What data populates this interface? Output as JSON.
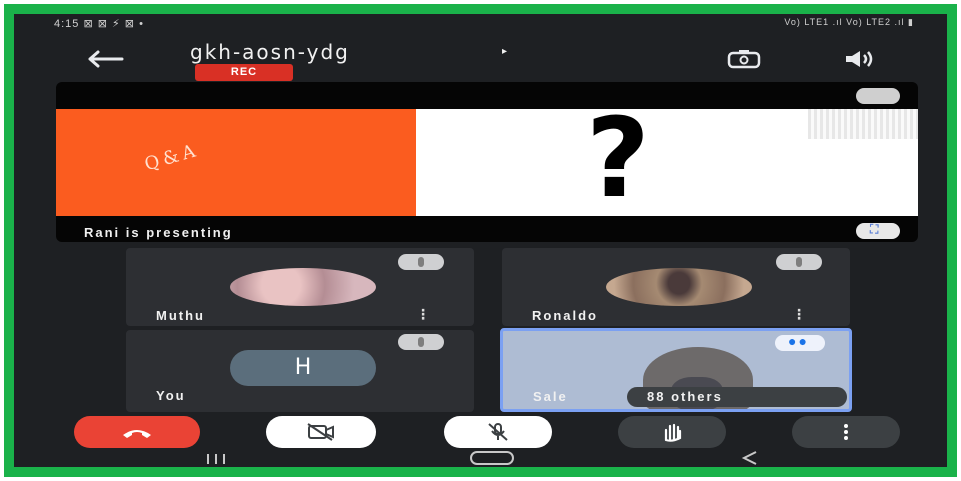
{
  "status_bar": {
    "time": "4:15",
    "left_indicators": "⊠ ⊠ ⚡ ⊠ •",
    "right_indicators": "Vo) LTE1 .ıl Vo) LTE2 .ıl ▮"
  },
  "header": {
    "meeting_code": "gkh-aosn-ydg",
    "code_arrow": "▸",
    "rec_badge": "REC"
  },
  "presentation": {
    "slide_left_text": "Q&A",
    "slide_right_symbol": "?",
    "presenter_label": "Rani is presenting"
  },
  "participants": [
    {
      "name": "Muthu"
    },
    {
      "name": "Ronaldo"
    },
    {
      "name": "You",
      "initial": "H"
    },
    {
      "name": "Sale",
      "others": "88 others"
    }
  ],
  "colors": {
    "border": "#1ab24a",
    "background": "#1e2023",
    "end_call": "#ea4335",
    "rec": "#d93025",
    "slide_orange": "#fb5c1f",
    "active_tile_border": "#7ba0f2"
  }
}
